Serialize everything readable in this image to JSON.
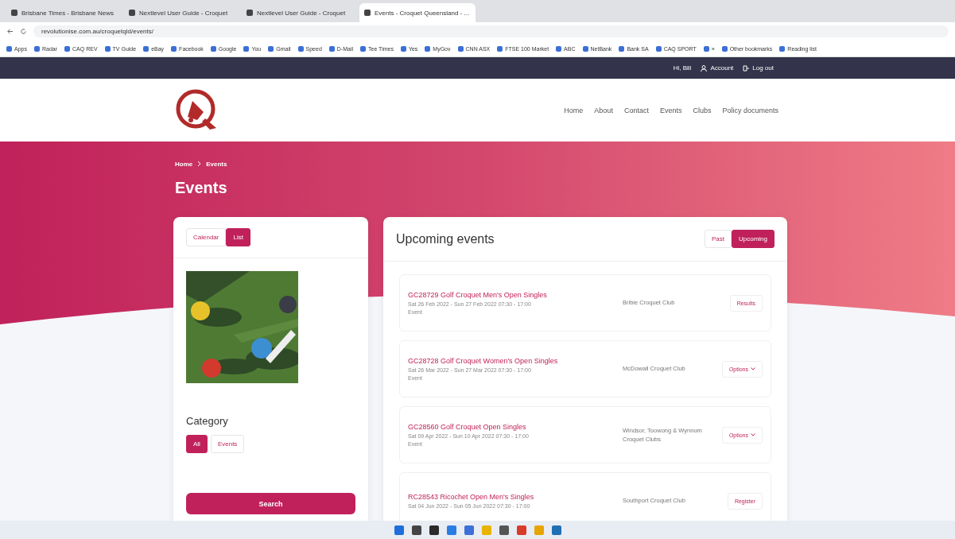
{
  "browser": {
    "tabs": [
      {
        "title": "Brisbane Times - Brisbane News",
        "selected": false
      },
      {
        "title": "Nextlevel User Guide - Croquet",
        "selected": false
      },
      {
        "title": "Nextlevel User Guide - Croquet",
        "selected": false
      },
      {
        "title": "Events - Croquet Queensland - ...",
        "selected": true
      }
    ],
    "url": "revolutionise.com.au/croquetqld/events/",
    "bookmarks": [
      "Apps",
      "Radar",
      "CAQ REV",
      "TV Guide",
      "eBay",
      "Facebook",
      "Google",
      "You",
      "Gmail",
      "Speed",
      "D-Mail",
      "Tee Times",
      "Yes",
      "MyGov",
      "CNN ASX",
      "FTSE 100 Market",
      "ABC",
      "NetBank",
      "Bank SA",
      "CAQ SPORT",
      "»",
      "Other bookmarks",
      "Reading list"
    ]
  },
  "topbar": {
    "greeting": "Hi, Bill",
    "links": [
      {
        "kind": "account",
        "label": "Account"
      },
      {
        "kind": "logout",
        "label": "Log out"
      }
    ]
  },
  "nav": [
    "Home",
    "About",
    "Contact",
    "Events",
    "Clubs",
    "Policy documents"
  ],
  "hero": {
    "breadcrumb": [
      "Home",
      "Events"
    ],
    "title": "Events"
  },
  "sidebar": {
    "views": [
      {
        "label": "Calendar",
        "selected": false
      },
      {
        "label": "List",
        "selected": true
      }
    ],
    "category_title": "Category",
    "categories": [
      {
        "label": "All",
        "selected": true
      },
      {
        "label": "Events",
        "selected": false
      }
    ],
    "search": "Search"
  },
  "events_panel": {
    "title": "Upcoming events",
    "filters": [
      {
        "label": "Past",
        "selected": false
      },
      {
        "label": "Upcoming",
        "selected": true
      }
    ],
    "events": [
      {
        "title": "GC28729 Golf Croquet Men's Open Singles",
        "dates": "Sat 26 Feb 2022 - Sun 27 Feb 2022 07:30 - 17:00",
        "type": "Event",
        "club": "Bribie Croquet Club",
        "action": "Results",
        "dropdown": false
      },
      {
        "title": "GC28728 Golf Croquet Women's Open Singles",
        "dates": "Sat 26 Mar 2022 - Sun 27 Mar 2022 07:30 - 17:00",
        "type": "Event",
        "club": "McDowall Croquet Club",
        "action": "Options",
        "dropdown": true
      },
      {
        "title": "GC28560 Golf Croquet Open Singles",
        "dates": "Sat 09 Apr 2022 - Sun 10 Apr 2022 07:30 - 17:00",
        "type": "Event",
        "club": "Windsor, Toowong & Wynnum Croquet Clubs",
        "action": "Options",
        "dropdown": true
      },
      {
        "title": "RC28543 Ricochet Open Men's Singles",
        "dates": "Sat 04 Jun 2022 - Sun 05 Jun 2022 07:30 - 17:00",
        "club": "Southport Croquet Club",
        "action": "Register",
        "dropdown": false
      }
    ]
  }
}
